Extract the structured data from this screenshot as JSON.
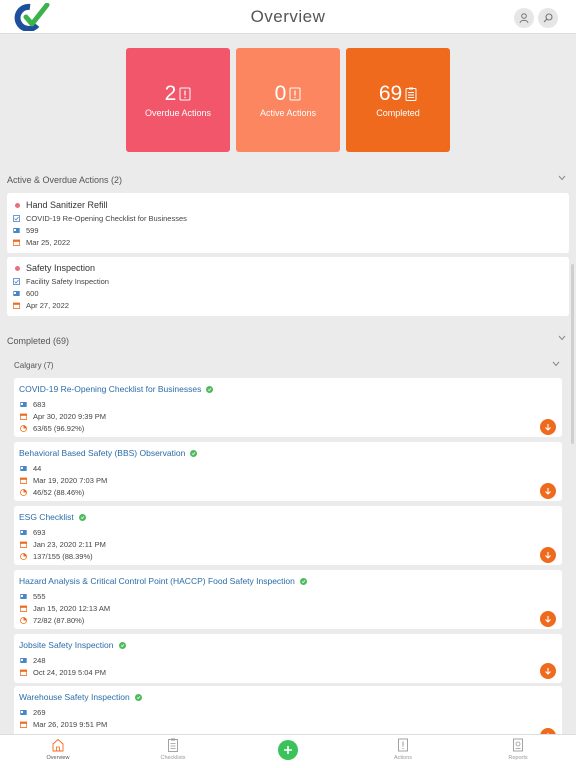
{
  "header": {
    "title": "Overview"
  },
  "tiles": [
    {
      "value": "2",
      "label": "Overdue Actions",
      "color": "#f2566a"
    },
    {
      "value": "0",
      "label": "Active Actions",
      "color": "#fb8660"
    },
    {
      "value": "69",
      "label": "Completed",
      "color": "#f06a1e"
    }
  ],
  "active_section": {
    "title": "Active & Overdue Actions (2)"
  },
  "actions": [
    {
      "title": "Hand Sanitizer Refill",
      "checklist": "COVID-19 Re-Opening Checklist for Businesses",
      "id": "599",
      "date": "Mar 25, 2022"
    },
    {
      "title": "Safety Inspection",
      "checklist": "Facility Safety Inspection",
      "id": "600",
      "date": "Apr 27, 2022"
    }
  ],
  "completed_section": {
    "title": "Completed (69)",
    "group": "Calgary (7)"
  },
  "completed": [
    {
      "title": "COVID-19 Re-Opening Checklist for Businesses",
      "id": "683",
      "date": "Apr 30, 2020 9:39 PM",
      "score": "63/65 (96.92%)"
    },
    {
      "title": "Behavioral Based Safety (BBS) Observation",
      "id": "44",
      "date": "Mar 19, 2020 7:03 PM",
      "score": "46/52 (88.46%)"
    },
    {
      "title": "ESG Checklist",
      "id": "693",
      "date": "Jan 23, 2020 2:11 PM",
      "score": "137/155 (88.39%)"
    },
    {
      "title": "Hazard Analysis & Critical Control Point (HACCP) Food Safety Inspection",
      "id": "555",
      "date": "Jan 15, 2020 12:13 AM",
      "score": "72/82 (87.80%)"
    },
    {
      "title": "Jobsite Safety Inspection",
      "id": "248",
      "date": "Oct 24, 2019 5:04 PM",
      "score": ""
    },
    {
      "title": "Warehouse Safety Inspection",
      "id": "269",
      "date": "Mar 26, 2019 9:51 PM",
      "score": ""
    }
  ],
  "bottom_nav": {
    "overview": "Overview",
    "checklists": "Checklists",
    "actions": "Actions",
    "reports": "Reports"
  },
  "colors": {
    "accent": "#f06a1e",
    "link": "#2a6ca8",
    "success": "#4cbb5c",
    "overdue_dot": "#e8707c"
  }
}
